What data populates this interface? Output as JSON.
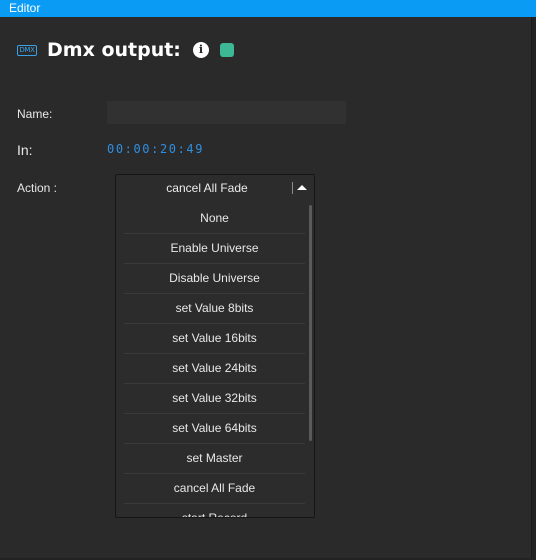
{
  "window": {
    "title": "Editor"
  },
  "header": {
    "icon_text": "DMX",
    "title": "Dmx output:",
    "info_glyph": "i",
    "accent_color": "#3cb896"
  },
  "fields": {
    "name_label": "Name:",
    "name_value": "",
    "in_label": "In:",
    "in_value": "00:00:20:49",
    "action_label": "Action :"
  },
  "action_dropdown": {
    "selected": "cancel All Fade",
    "open": true,
    "options": [
      "None",
      "Enable Universe",
      "Disable Universe",
      "set Value 8bits",
      "set Value 16bits",
      "set Value 24bits",
      "set Value 32bits",
      "set Value 64bits",
      "set Master",
      "cancel All Fade",
      "start Record"
    ]
  },
  "colors": {
    "titlebar": "#0a9bf5",
    "background": "#2a2a2a",
    "timecode": "#2f8fe0"
  }
}
